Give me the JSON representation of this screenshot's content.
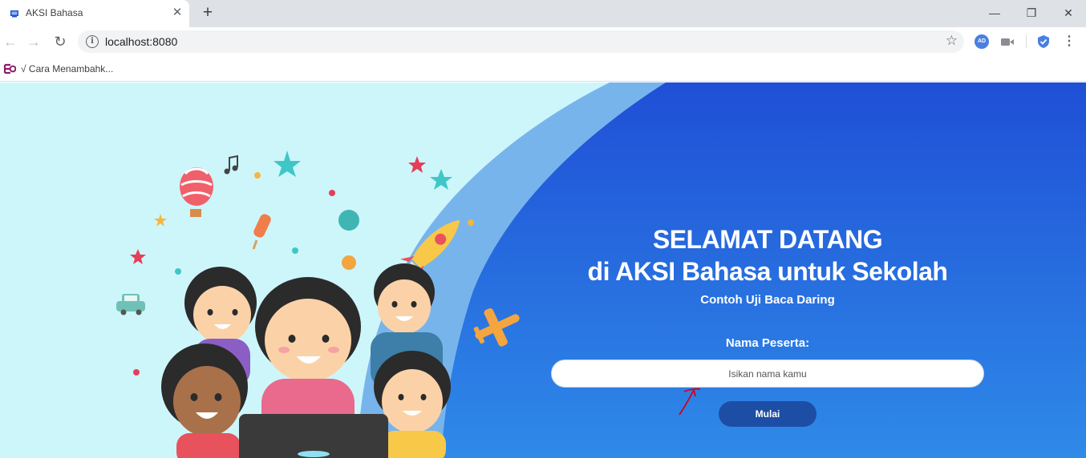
{
  "browser": {
    "tab": {
      "title": "AKSI Bahasa",
      "close_glyph": "✕"
    },
    "new_tab_glyph": "+",
    "window_controls": {
      "minimize": "—",
      "restore": "❐",
      "close": "✕"
    },
    "nav": {
      "back": "←",
      "forward": "→",
      "reload": "↻"
    },
    "address": {
      "url": "localhost:8080",
      "info_glyph": "i",
      "star_glyph": "☆"
    },
    "extensions": {
      "ad_badge": "AD"
    },
    "menu_glyph": "⋮",
    "bookmarks": [
      {
        "label": "√ Cara Menambahk..."
      }
    ]
  },
  "page": {
    "title_line1": "SELAMAT DATANG",
    "title_line2": "di AKSI Bahasa untuk Sekolah",
    "subtitle": "Contoh Uji Baca Daring",
    "name_label": "Nama Peserta:",
    "name_placeholder": "Isikan nama kamu",
    "name_value": "",
    "start_button": "Mulai"
  },
  "colors": {
    "tab_strip": "#dee1e6",
    "sky_light": "#cdf6fb",
    "wave": "#78b4ec",
    "panel_blue_top": "#1f4fd6",
    "panel_blue_bottom": "#2f8ae8",
    "button": "#1d4ea5",
    "annotation": "#d0021b"
  }
}
